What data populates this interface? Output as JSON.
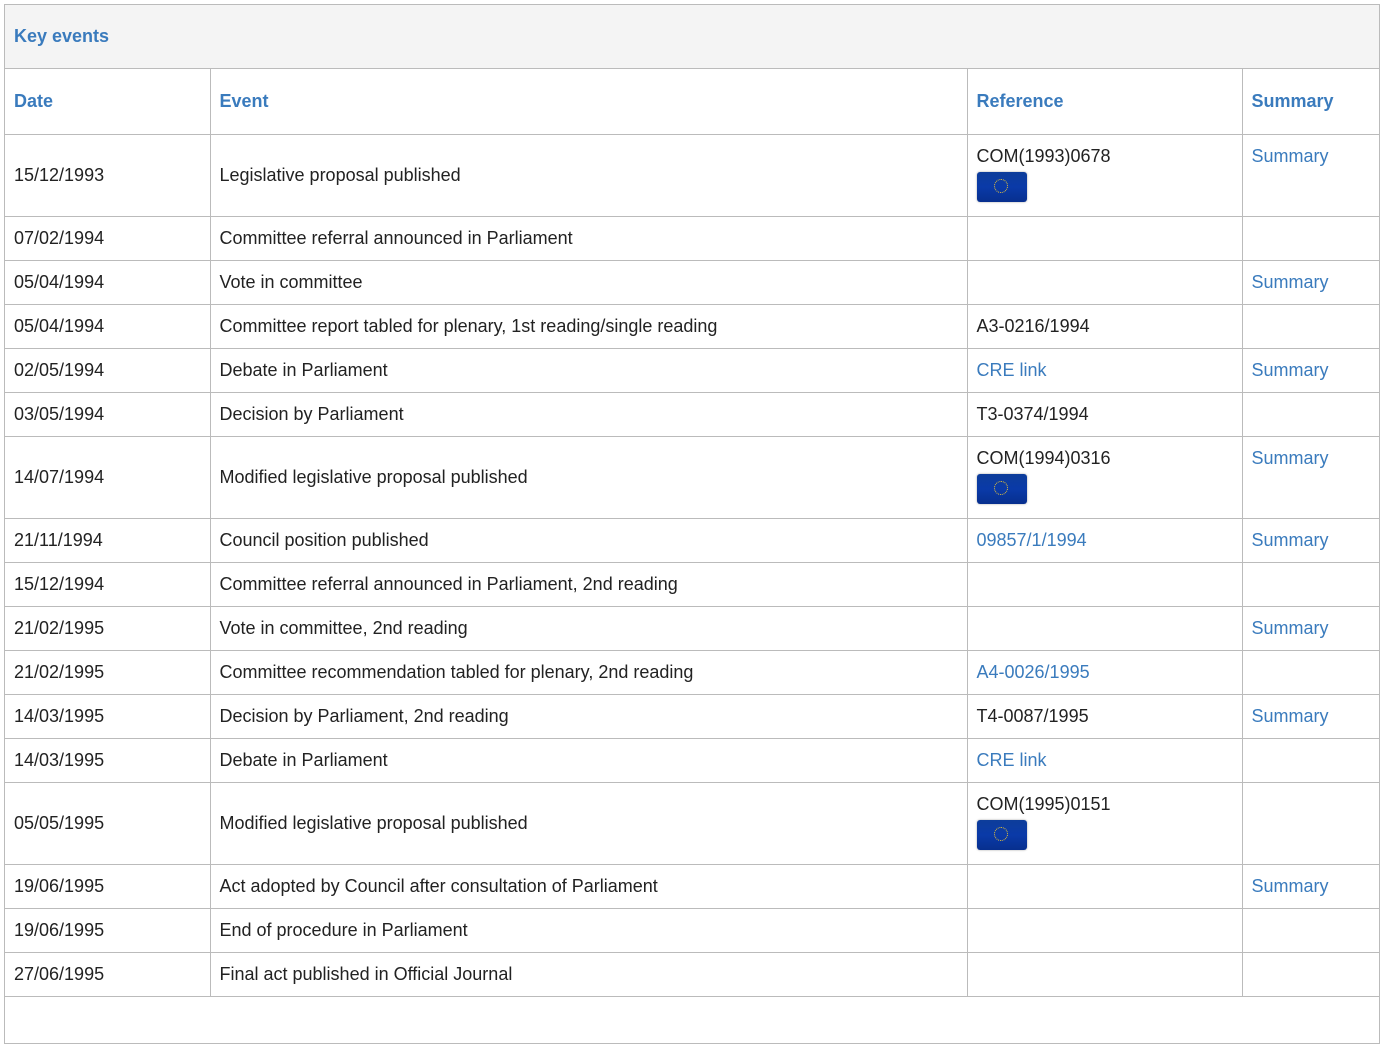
{
  "panel": {
    "title": "Key events"
  },
  "table": {
    "headers": {
      "date": "Date",
      "event": "Event",
      "reference": "Reference",
      "summary": "Summary"
    },
    "rows": [
      {
        "date": "15/12/1993",
        "event": "Legislative proposal published",
        "reference": "COM(1993)0678",
        "summary": "Summary"
      },
      {
        "date": "07/02/1994",
        "event": "Committee referral announced in Parliament",
        "reference": "",
        "summary": ""
      },
      {
        "date": "05/04/1994",
        "event": "Vote in committee",
        "reference": "",
        "summary": "Summary"
      },
      {
        "date": "05/04/1994",
        "event": "Committee report tabled for plenary, 1st reading/single reading",
        "reference": "A3-0216/1994",
        "summary": ""
      },
      {
        "date": "02/05/1994",
        "event": "Debate in Parliament",
        "reference": "CRE link",
        "summary": "Summary"
      },
      {
        "date": "03/05/1994",
        "event": "Decision by Parliament",
        "reference": "T3-0374/1994",
        "summary": ""
      },
      {
        "date": "14/07/1994",
        "event": "Modified legislative proposal published",
        "reference": "COM(1994)0316",
        "summary": "Summary"
      },
      {
        "date": "21/11/1994",
        "event": "Council position published",
        "reference": "09857/1/1994",
        "summary": "Summary"
      },
      {
        "date": "15/12/1994",
        "event": "Committee referral announced in Parliament, 2nd reading",
        "reference": "",
        "summary": ""
      },
      {
        "date": "21/02/1995",
        "event": "Vote in committee, 2nd reading",
        "reference": "",
        "summary": "Summary"
      },
      {
        "date": "21/02/1995",
        "event": "Committee recommendation tabled for plenary, 2nd reading",
        "reference": "A4-0026/1995",
        "summary": ""
      },
      {
        "date": "14/03/1995",
        "event": "Decision by Parliament, 2nd reading",
        "reference": "T4-0087/1995",
        "summary": "Summary"
      },
      {
        "date": "14/03/1995",
        "event": "Debate in Parliament",
        "reference": "CRE link",
        "summary": ""
      },
      {
        "date": "05/05/1995",
        "event": "Modified legislative proposal published",
        "reference": "COM(1995)0151",
        "summary": ""
      },
      {
        "date": "19/06/1995",
        "event": "Act adopted by Council after consultation of Parliament",
        "reference": "",
        "summary": "Summary"
      },
      {
        "date": "19/06/1995",
        "event": "End of procedure in Parliament",
        "reference": "",
        "summary": ""
      },
      {
        "date": "27/06/1995",
        "event": "Final act published in Official Journal",
        "reference": "",
        "summary": ""
      }
    ]
  }
}
